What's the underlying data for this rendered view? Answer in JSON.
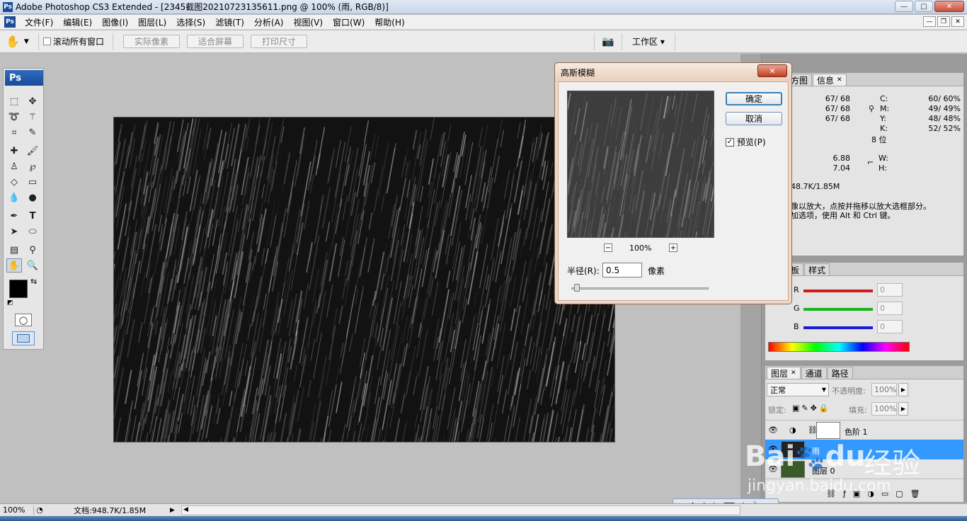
{
  "window": {
    "title": "Adobe Photoshop CS3 Extended - [2345截图20210723135611.png @ 100% (雨, RGB/8)]",
    "app_icon": "Ps",
    "controls": {
      "minimize": "—",
      "maximize": "□",
      "close": "✕"
    }
  },
  "menubar": {
    "items": [
      "文件(F)",
      "编辑(E)",
      "图像(I)",
      "图层(L)",
      "选择(S)",
      "滤镜(T)",
      "分析(A)",
      "视图(V)",
      "窗口(W)",
      "帮助(H)"
    ]
  },
  "options_bar": {
    "scroll_all_label": "滚动所有窗口",
    "scroll_all_checked": false,
    "actual_pixels": "实际像素",
    "fit_screen": "适合屏幕",
    "print_size": "打印尺寸",
    "workspace": "工作区 ▾"
  },
  "toolbox": {
    "logo": "Ps"
  },
  "dialog": {
    "title": "高斯模糊",
    "ok": "确定",
    "cancel": "取消",
    "preview_label": "预览(P)",
    "preview_checked": true,
    "zoom": "100%",
    "radius_label": "半径(R):",
    "radius_value": "0.5",
    "radius_unit": "像素",
    "slider_fraction": 0.02
  },
  "info_panel": {
    "tabs": [
      "直方图",
      "信息"
    ],
    "rgb": [
      "67/ 68",
      "67/ 68",
      "67/ 68"
    ],
    "cmyk_labels": [
      "C:",
      "M:",
      "Y:",
      "K:"
    ],
    "cmyk": [
      "60/ 60%",
      "49/ 49%",
      "48/ 48%",
      "52/ 52%"
    ],
    "bits": "8 位",
    "xy": [
      "6.88",
      "7.04"
    ],
    "wh_labels": [
      "W:",
      "H:"
    ],
    "doc": "48.7K/1.85M",
    "hint_line1": "像以放大，点按并拖移以放大选框部分。",
    "hint_line2": "加选项，使用 Alt 和 Ctrl 键。"
  },
  "color_panel": {
    "tabs": [
      "色板",
      "样式"
    ],
    "channels": [
      {
        "label": "R",
        "value": "0",
        "color": "#d11a1a"
      },
      {
        "label": "G",
        "value": "0",
        "color": "#19b21d"
      },
      {
        "label": "B",
        "value": "0",
        "color": "#1a1ad1"
      }
    ]
  },
  "layers_panel": {
    "tabs": [
      "图层",
      "通道",
      "路径"
    ],
    "blend_mode": "正常",
    "opacity_label": "不透明度:",
    "opacity": "100%",
    "lock_label": "锁定:",
    "fill_label": "填充:",
    "fill": "100%",
    "layers": [
      {
        "name": "色阶 1",
        "selected": false
      },
      {
        "name": "雨",
        "selected": true
      },
      {
        "name": "图层 0",
        "selected": false
      }
    ]
  },
  "statusbar": {
    "zoom": "100%",
    "doc": "文档:948.7K/1.85M"
  },
  "watermark": {
    "brand": "Bai",
    "brand2": "du",
    "brand_cn": "经验",
    "url": "jingyan.baidu.com"
  },
  "colors": {
    "accent": "#3399ff",
    "selection": "#3399ff",
    "dialog_frame": "#eed9c8"
  }
}
